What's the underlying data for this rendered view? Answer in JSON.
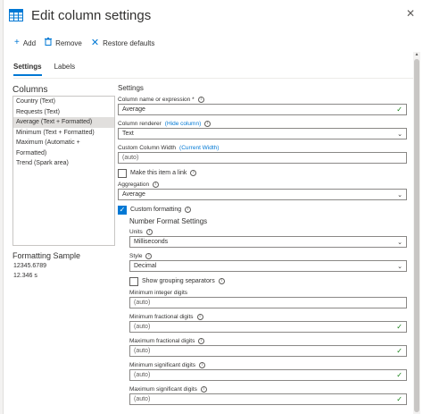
{
  "header": {
    "title": "Edit column settings"
  },
  "toolbar": {
    "add": "Add",
    "remove": "Remove",
    "restore": "Restore defaults"
  },
  "tabs": [
    {
      "label": "Settings",
      "active": true
    },
    {
      "label": "Labels",
      "active": false
    }
  ],
  "columns": {
    "title": "Columns",
    "items": [
      "Country (Text)",
      "Requests (Text)",
      "Average (Text + Formatted)",
      "Minimum (Text + Formatted)",
      "Maximum (Automatic +",
      "Formatted)",
      "Trend (Spark area)"
    ],
    "selected_index": 2
  },
  "formatting_sample": {
    "title": "Formatting Sample",
    "raw": "12345.6789",
    "formatted": "12.346 s"
  },
  "settings": {
    "title": "Settings",
    "column_name_label": "Column name or expression *",
    "column_name_value": "Average",
    "renderer_label": "Column renderer",
    "renderer_link": "(Hide column)",
    "renderer_value": "Text",
    "width_label": "Custom Column Width",
    "width_link": "(Current Width)",
    "width_placeholder": "(auto)",
    "make_link_label": "Make this item a link",
    "aggregation_label": "Aggregation",
    "aggregation_value": "Average",
    "custom_formatting_label": "Custom formatting",
    "number_format_title": "Number Format Settings",
    "units_label": "Units",
    "units_value": "Milliseconds",
    "style_label": "Style",
    "style_value": "Decimal",
    "grouping_label": "Show grouping separators",
    "min_int_label": "Minimum integer digits",
    "min_int_value": "(auto)",
    "min_frac_label": "Minimum fractional digits",
    "min_frac_value": "(auto)",
    "max_frac_label": "Maximum fractional digits",
    "max_frac_value": "(auto)",
    "min_sig_label": "Minimum significant digits",
    "min_sig_value": "(auto)",
    "max_sig_label": "Maximum significant digits",
    "max_sig_value": "(auto)"
  },
  "icons": {
    "app": "grid-table-icon",
    "close": "close-icon",
    "add": "plus-icon",
    "remove": "trash-icon",
    "restore": "x-icon",
    "info": "info-icon",
    "dropdown": "chevron-down-icon",
    "valid": "checkmark-icon"
  },
  "colors": {
    "accent": "#0078d4",
    "valid": "#107c10"
  }
}
